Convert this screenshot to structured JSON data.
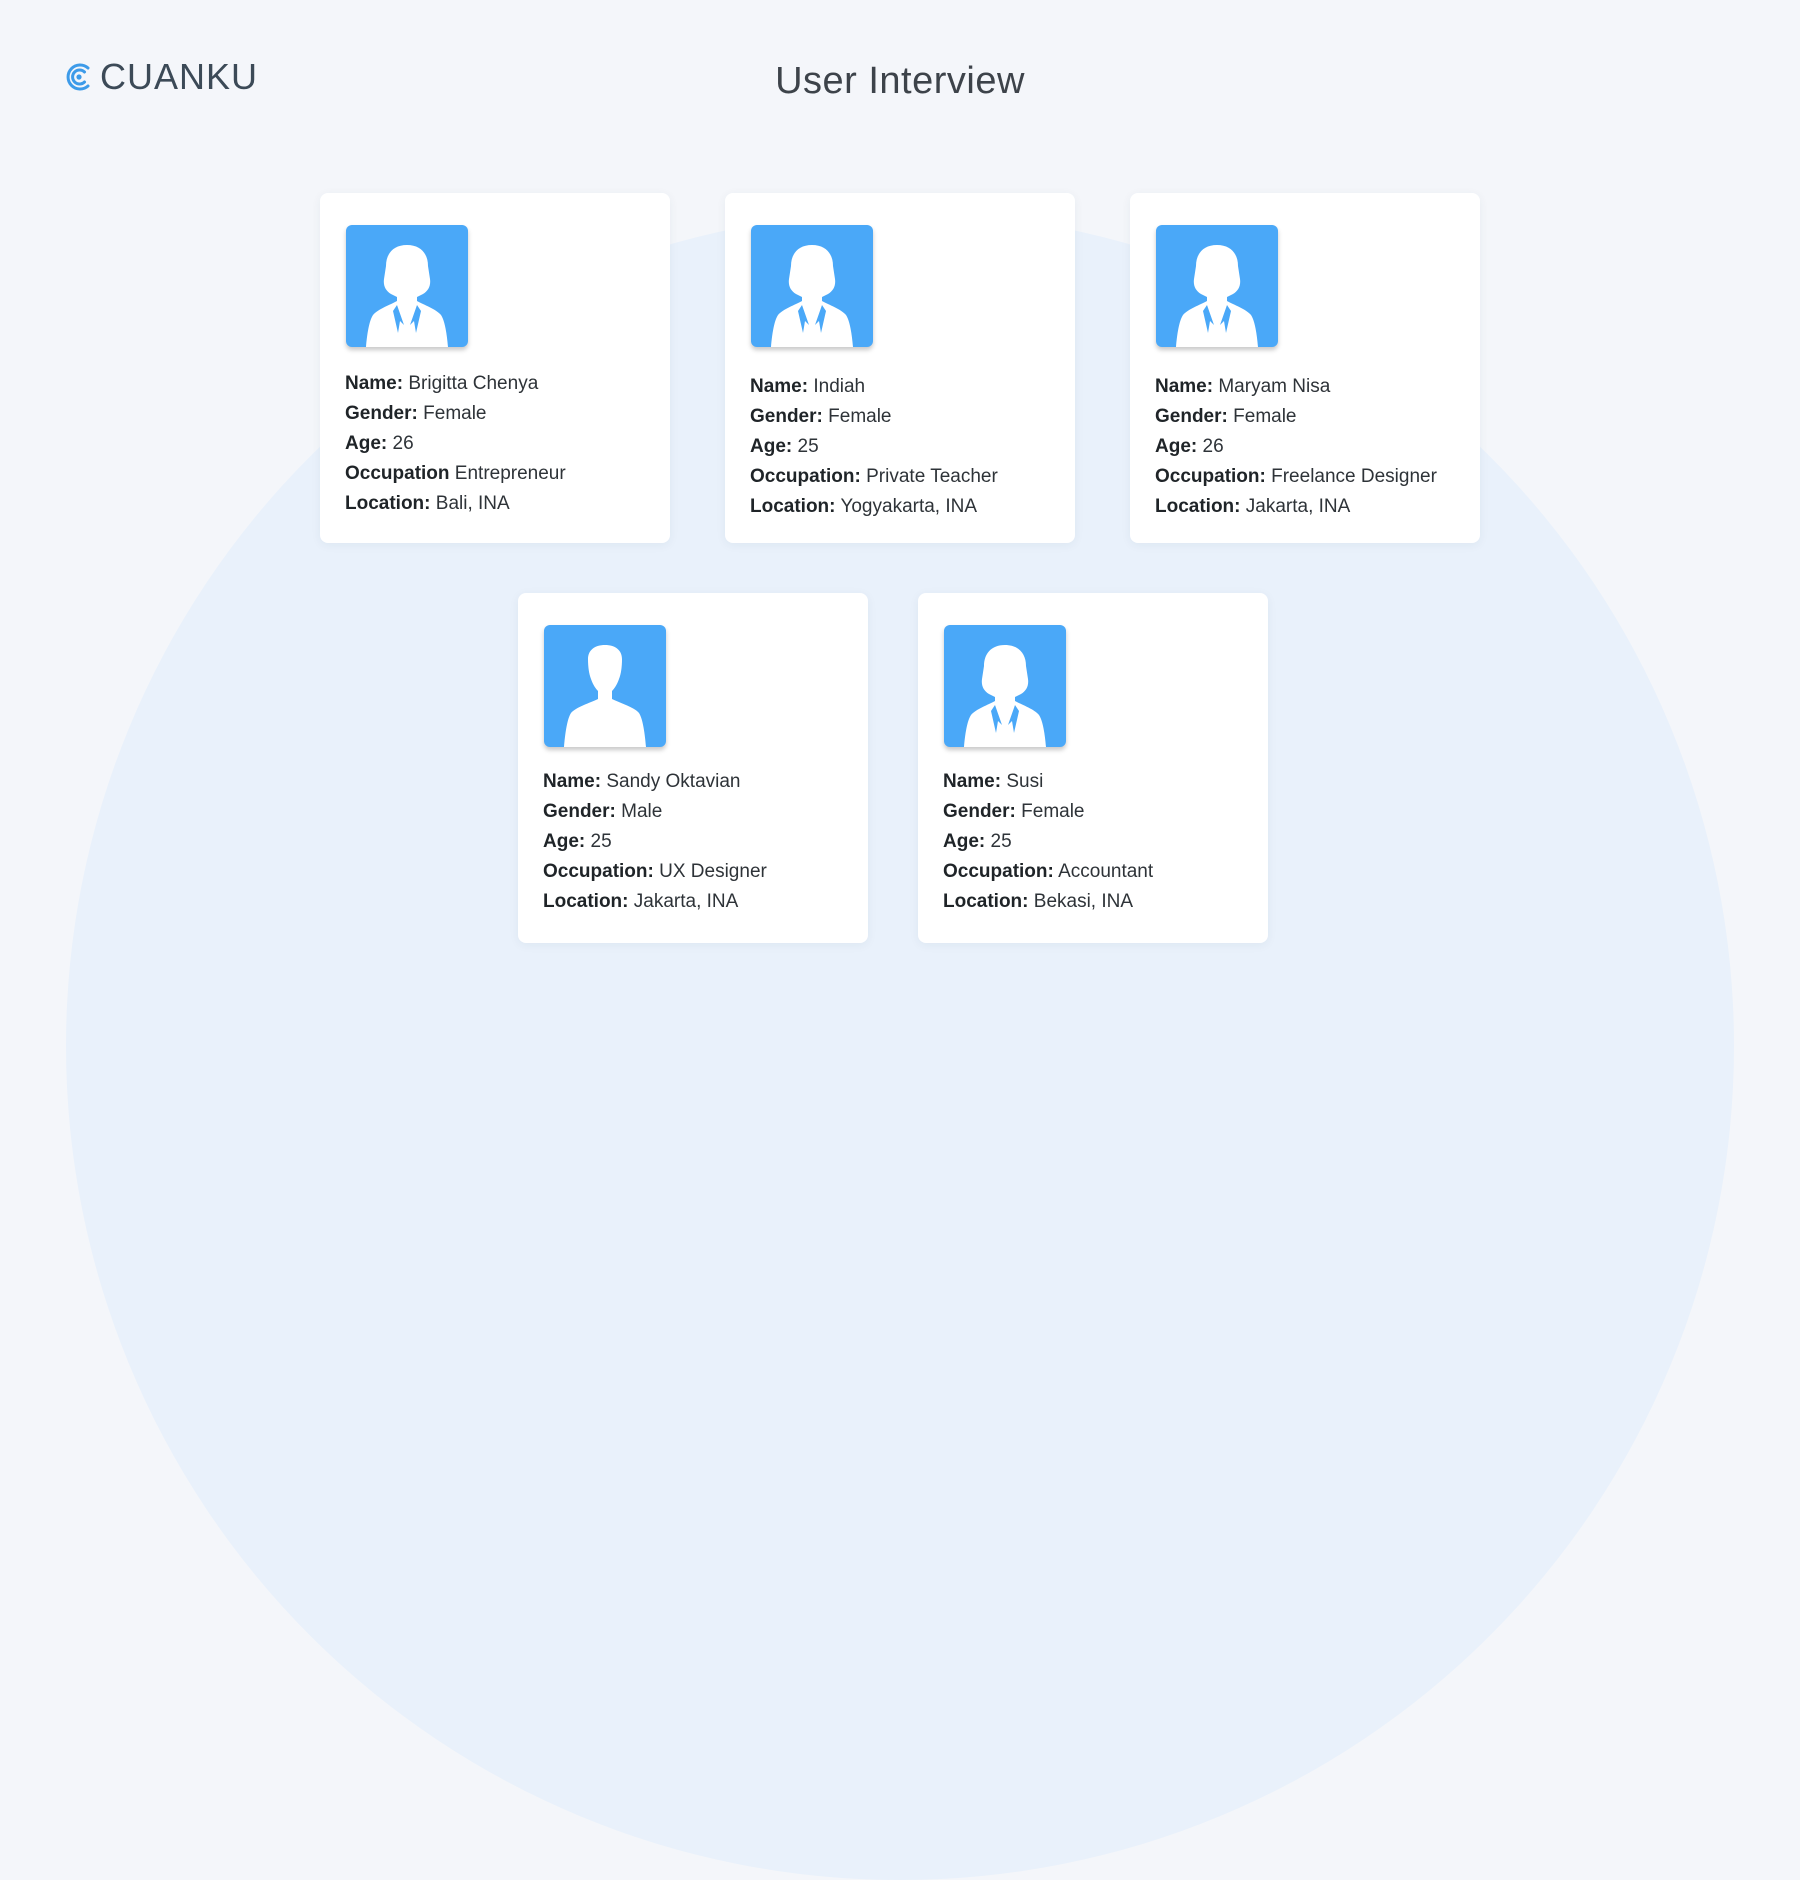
{
  "brand": {
    "logo_text": "CUANKU",
    "icon": "cuanku-logo-icon",
    "accent_color": "#3d9be9"
  },
  "page": {
    "title": "User Interview"
  },
  "colors": {
    "background": "#f4f6fa",
    "avatar_bg": "#4aa8f8",
    "card_bg": "#ffffff"
  },
  "cards": [
    {
      "avatar_icon": "female-avatar-icon",
      "name_label": "Name:",
      "name": "Brigitta Chenya",
      "gender_label": "Gender:",
      "gender": "Female",
      "age_label": "Age:",
      "age": "26",
      "occupation_label": "Occupation",
      "occupation": "Entrepreneur",
      "location_label": "Location:",
      "location": "Bali, INA"
    },
    {
      "avatar_icon": "female-avatar-icon",
      "name_label": "Name:",
      "name": "Indiah",
      "gender_label": "Gender:",
      "gender": "Female",
      "age_label": "Age:",
      "age": "25",
      "occupation_label": "Occupation:",
      "occupation": "Private Teacher",
      "location_label": "Location:",
      "location": "Yogyakarta, INA"
    },
    {
      "avatar_icon": "female-avatar-icon",
      "name_label": "Name:",
      "name": "Maryam Nisa",
      "gender_label": "Gender:",
      "gender": "Female",
      "age_label": "Age:",
      "age": "26",
      "occupation_label": "Occupation:",
      "occupation": "Freelance Designer",
      "location_label": "Location:",
      "location": "Jakarta, INA"
    },
    {
      "avatar_icon": "male-avatar-icon",
      "name_label": "Name:",
      "name": "Sandy Oktavian",
      "gender_label": "Gender:",
      "gender": "Male",
      "age_label": "Age:",
      "age": "25",
      "occupation_label": "Occupation:",
      "occupation": "UX Designer",
      "location_label": "Location:",
      "location": "Jakarta, INA"
    },
    {
      "avatar_icon": "female-avatar-icon",
      "name_label": "Name:",
      "name": "Susi",
      "gender_label": "Gender:",
      "gender": "Female",
      "age_label": "Age:",
      "age": "25",
      "occupation_label": "Occupation:",
      "occupation": "Accountant",
      "location_label": "Location:",
      "location": "Bekasi, INA"
    }
  ]
}
